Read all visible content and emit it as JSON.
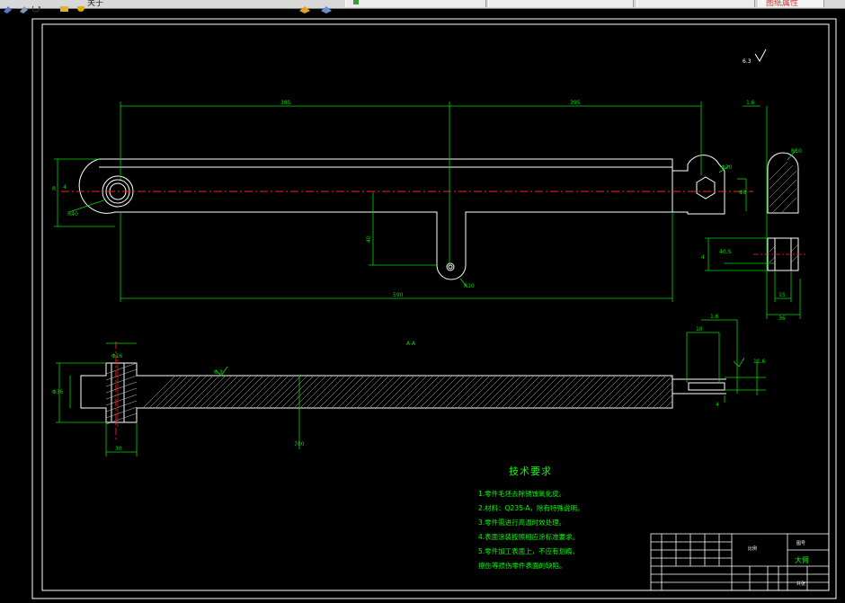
{
  "toolbar": {
    "menu_label": "关于",
    "tab1_text": "",
    "tab2_text": "",
    "tab3_text": "",
    "panel_label": "图纸属性"
  },
  "drawing": {
    "title_block": {
      "part_name": "大臂",
      "material_label": "比例",
      "sheet_label": "共张",
      "drawing_no": "图号"
    },
    "tech_requirements": {
      "heading": "技术要求",
      "items": [
        "1.零件毛坯去除锈蚀氧化皮。",
        "2.材料：Q235-A，除有特殊说明。",
        "3.零件需进行高温时效处理。",
        "4.表面涂装按照相应涂标准要求。",
        "5.零件加工表面上，不应有划痕、",
        "擦伤等损伤零件表面的缺陷。"
      ]
    },
    "top_view": {
      "dim_left_span": "385",
      "dim_right_span": "395",
      "dim_total": "590",
      "dim_height": "R",
      "dim_slot_depth": "40",
      "dim_left_end": "R40",
      "dim_hole": "Φ20",
      "dim_slot_r": "R10",
      "dim_end_h": "4",
      "dim_right_hole": "Φ8",
      "dim_right_top": "1.6"
    },
    "side_view": {
      "dim_r": "R10",
      "dim_slot": "40.5",
      "dim_w1": "15",
      "dim_w2": "36",
      "dim_thk": "4"
    },
    "section_view": {
      "label_a": "A-A",
      "dim_hub": "Φ16",
      "dim_left_h": "Φ36",
      "dim_hub_w": "30",
      "dim_right_1": "10",
      "dim_right_2": "1.6",
      "dim_right_3": "11.6",
      "dim_right_4": "4",
      "dim_len": "700",
      "roughness": "6.3",
      "roughness_top": "6.3"
    }
  }
}
